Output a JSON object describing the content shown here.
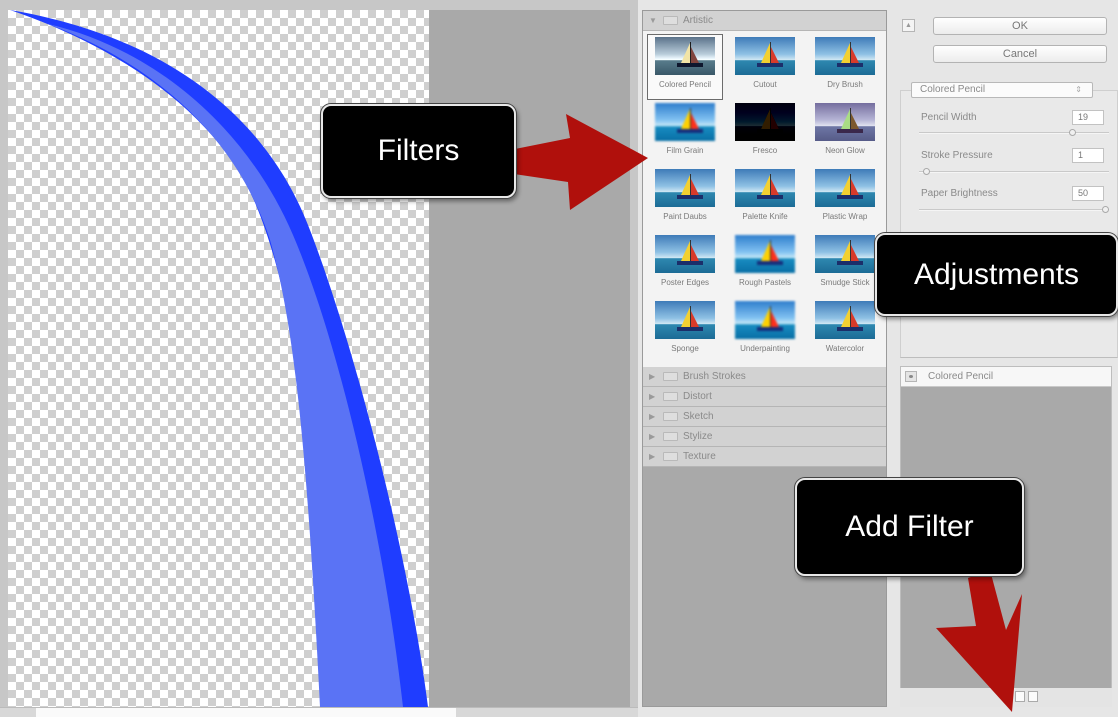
{
  "dialog": {
    "ok_label": "OK",
    "cancel_label": "Cancel"
  },
  "gallery": {
    "categories": [
      {
        "label": "Artistic",
        "expanded": true
      },
      {
        "label": "Brush Strokes",
        "expanded": false
      },
      {
        "label": "Distort",
        "expanded": false
      },
      {
        "label": "Sketch",
        "expanded": false
      },
      {
        "label": "Stylize",
        "expanded": false
      },
      {
        "label": "Texture",
        "expanded": false
      }
    ],
    "artistic_filters": [
      "Colored Pencil",
      "Cutout",
      "Dry Brush",
      "Film Grain",
      "Fresco",
      "Neon Glow",
      "Paint Daubs",
      "Palette Knife",
      "Plastic Wrap",
      "Poster Edges",
      "Rough Pastels",
      "Smudge Stick",
      "Sponge",
      "Underpainting",
      "Watercolor"
    ],
    "selected_filter": "Colored Pencil"
  },
  "adjustments": {
    "filter_select": "Colored Pencil",
    "params": [
      {
        "label": "Pencil Width",
        "value": "19",
        "fraction": 0.82
      },
      {
        "label": "Stroke Pressure",
        "value": "1",
        "fraction": 0.02
      },
      {
        "label": "Paper Brightness",
        "value": "50",
        "fraction": 1.0
      }
    ]
  },
  "layers": {
    "items": [
      "Colored Pencil"
    ]
  },
  "callouts": {
    "filters": "Filters",
    "adjustments": "Adjustments",
    "add_filter": "Add Filter"
  },
  "colors": {
    "stroke": "#1f3dff",
    "stroke_light": "#5a73f5",
    "callout_bg": "#000000",
    "arrow": "#b0100c"
  }
}
